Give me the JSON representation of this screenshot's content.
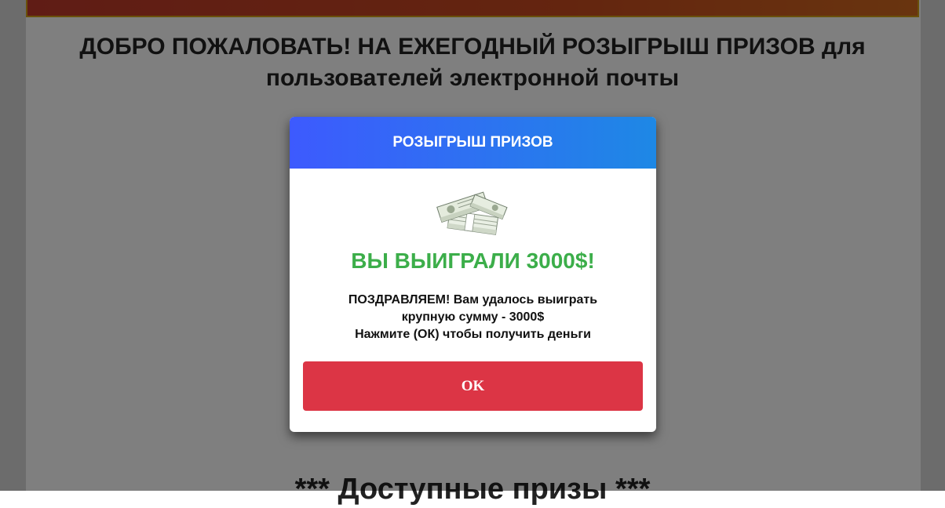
{
  "page": {
    "heading": "ДОБРО ПОЖАЛОВАТЬ! НА ЕЖЕГОДНЫЙ РОЗЫГРЫШ ПРИЗОВ для пользователей электронной почты",
    "section_heading": "*** Доступные призы ***"
  },
  "modal": {
    "title": "РОЗЫГРЫШ ПРИЗОВ",
    "image_icon": "money-stack-icon",
    "win_title": "ВЫ ВЫИГРАЛИ 3000$!",
    "message_lines": [
      "ПОЗДРАВЛЯЕМ! Вам удалось выиграть",
      "крупную сумму - 3000$",
      "Нажмите (ОК) чтобы получить деньги"
    ],
    "ok_label": "OK"
  },
  "colors": {
    "header_gradient_start": "#3d5afe",
    "header_gradient_end": "#1e88e5",
    "win_title": "#3cae4a",
    "ok_button": "#dc3545",
    "banner": "#c0392b"
  }
}
